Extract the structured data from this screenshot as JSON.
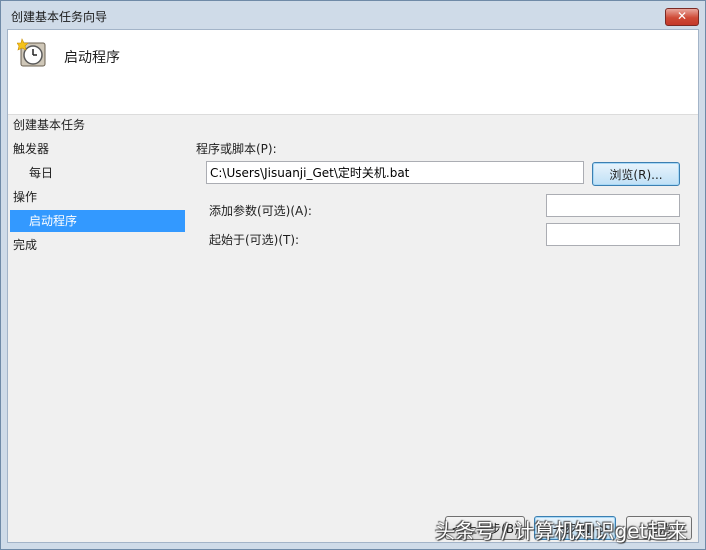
{
  "window": {
    "title": "创建基本任务向导",
    "close_label": "✕"
  },
  "header": {
    "title": "启动程序",
    "icon": "clock-icon"
  },
  "nav": {
    "items": [
      {
        "label": "创建基本任务"
      },
      {
        "label": "触发器"
      },
      {
        "label": "每日"
      },
      {
        "label": "操作"
      },
      {
        "label": "启动程序",
        "selected": true
      },
      {
        "label": "完成"
      }
    ]
  },
  "form": {
    "program_label": "程序或脚本(P):",
    "program_value": "C:\\Users\\Jisuanji_Get\\定时关机.bat",
    "browse_label": "浏览(R)...",
    "args_label": "添加参数(可选)(A):",
    "args_value": "",
    "start_in_label": "起始于(可选)(T):",
    "start_in_value": ""
  },
  "footer": {
    "back_label": "< 上一步(B)",
    "next_label": "下一步(N) >",
    "cancel_label": "取消"
  },
  "watermark": "头条号 / 计算机知识get起来",
  "colors": {
    "selection": "#3399ff",
    "client_bg": "#f0f0f0",
    "frame": "#cfdbe8"
  }
}
